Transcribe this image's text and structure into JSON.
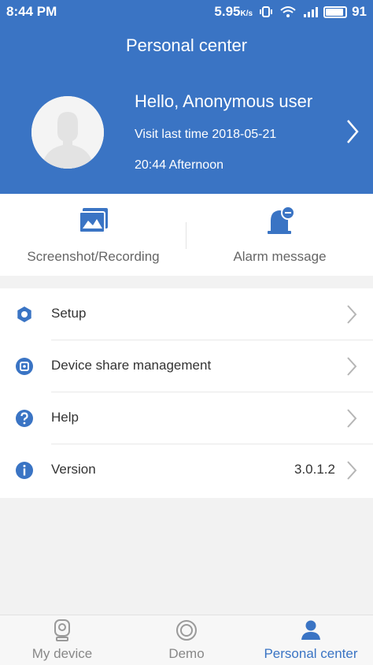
{
  "colors": {
    "accent": "#3a74c4",
    "background": "#f2f2f2",
    "inactive": "#888888"
  },
  "status_bar": {
    "time": "8:44 PM",
    "speed": "5.95",
    "speed_unit": "K/s",
    "battery": "91"
  },
  "header": {
    "title": "Personal center",
    "greeting": "Hello, Anonymous user",
    "visit_label": "Visit last time 2018-05-21",
    "visit_time": "20:44 Afternoon"
  },
  "shortcuts": [
    {
      "label": "Screenshot/Recording",
      "icon": "image-icon"
    },
    {
      "label": "Alarm message",
      "icon": "bell-icon"
    }
  ],
  "menu": [
    {
      "label": "Setup",
      "icon": "gear-icon",
      "value": ""
    },
    {
      "label": "Device share management",
      "icon": "share-icon",
      "value": ""
    },
    {
      "label": "Help",
      "icon": "question-icon",
      "value": ""
    },
    {
      "label": "Version",
      "icon": "info-icon",
      "value": "3.0.1.2"
    }
  ],
  "tabs": [
    {
      "label": "My device",
      "icon": "camera-icon",
      "active": false
    },
    {
      "label": "Demo",
      "icon": "demo-icon",
      "active": false
    },
    {
      "label": "Personal center",
      "icon": "person-icon",
      "active": true
    }
  ]
}
